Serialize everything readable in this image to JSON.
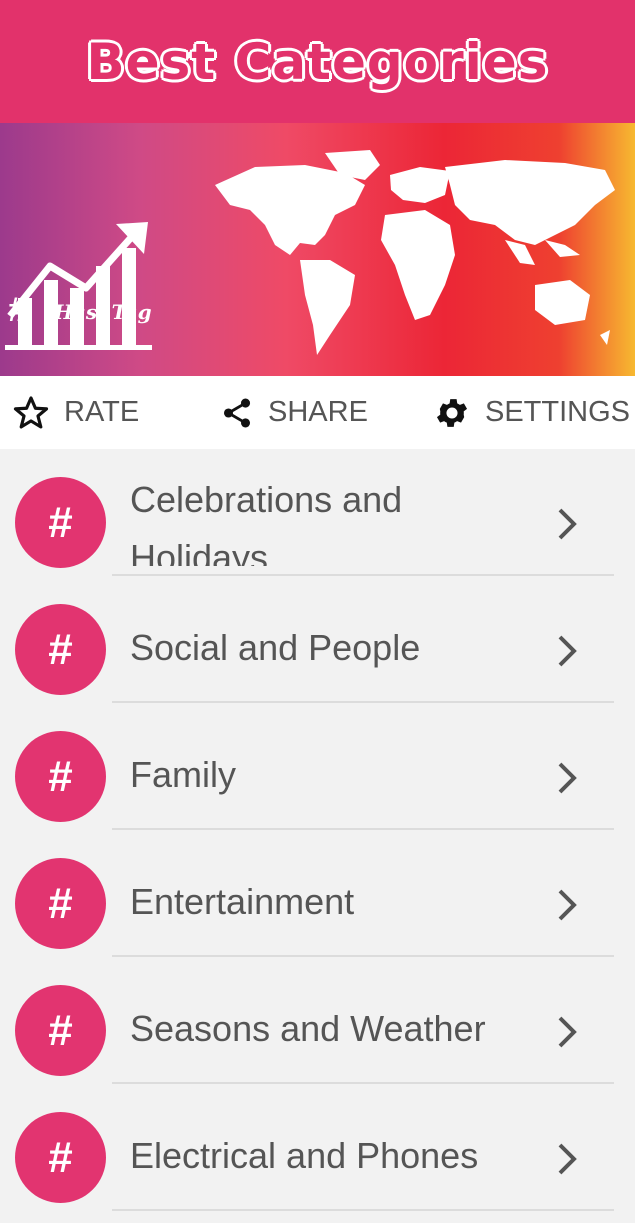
{
  "header": {
    "title": "Best Categories"
  },
  "banner": {
    "hash_symbol": "#",
    "hash_label": "HashTag"
  },
  "actions": {
    "rate_label": "RATE",
    "share_label": "SHARE",
    "settings_label": "SETTINGS"
  },
  "categories": [
    {
      "label": "Celebrations and Holidays",
      "icon_text": "#"
    },
    {
      "label": "Social and People",
      "icon_text": "#"
    },
    {
      "label": "Family",
      "icon_text": "#"
    },
    {
      "label": "Entertainment",
      "icon_text": "#"
    },
    {
      "label": "Seasons and Weather",
      "icon_text": "#"
    },
    {
      "label": "Electrical and Phones",
      "icon_text": "#"
    }
  ],
  "colors": {
    "accent": "#e2326b",
    "icon_circle": "#e23470",
    "text": "#555555"
  }
}
